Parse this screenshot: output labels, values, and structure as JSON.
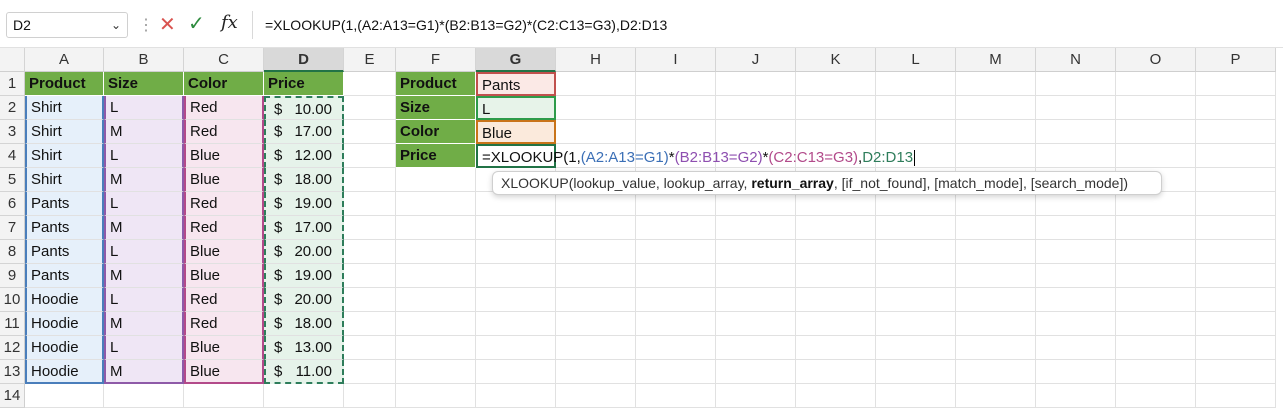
{
  "name_box": "D2",
  "formula_bar": "=XLOOKUP(1,(A2:A13=G1)*(B2:B13=G2)*(C2:C13=G3),D2:D13",
  "columns": [
    "A",
    "B",
    "C",
    "D",
    "E",
    "F",
    "G",
    "H",
    "I",
    "J",
    "K",
    "L",
    "M",
    "N",
    "O",
    "P"
  ],
  "rows": [
    "1",
    "2",
    "3",
    "4",
    "5",
    "6",
    "7",
    "8",
    "9",
    "10",
    "11",
    "12",
    "13",
    "14"
  ],
  "headers": {
    "a": "Product",
    "b": "Size",
    "c": "Color",
    "d": "Price"
  },
  "table": [
    [
      "Shirt",
      "L",
      "Red",
      "$",
      "10.00"
    ],
    [
      "Shirt",
      "M",
      "Red",
      "$",
      "17.00"
    ],
    [
      "Shirt",
      "L",
      "Blue",
      "$",
      "12.00"
    ],
    [
      "Shirt",
      "M",
      "Blue",
      "$",
      "18.00"
    ],
    [
      "Pants",
      "L",
      "Red",
      "$",
      "19.00"
    ],
    [
      "Pants",
      "M",
      "Red",
      "$",
      "17.00"
    ],
    [
      "Pants",
      "L",
      "Blue",
      "$",
      "20.00"
    ],
    [
      "Pants",
      "M",
      "Blue",
      "$",
      "19.00"
    ],
    [
      "Hoodie",
      "L",
      "Red",
      "$",
      "20.00"
    ],
    [
      "Hoodie",
      "M",
      "Red",
      "$",
      "18.00"
    ],
    [
      "Hoodie",
      "L",
      "Blue",
      "$",
      "13.00"
    ],
    [
      "Hoodie",
      "M",
      "Blue",
      "$",
      "11.00"
    ]
  ],
  "lookup": {
    "labels": [
      "Product",
      "Size",
      "Color",
      "Price"
    ],
    "values": [
      "Pants",
      "L",
      "Blue"
    ],
    "edit": {
      "p1": "=XLOOKUP(1,",
      "p2": "(A2:A13=G1)",
      "p3": "*",
      "p4": "(B2:B13=G2)",
      "p5": "*",
      "p6": "(C2:C13=G3)",
      "p7": ",",
      "p8": "D2:D13"
    }
  },
  "tooltip": {
    "before": "XLOOKUP(lookup_value, lookup_array, ",
    "bold": "return_array",
    "after": ", [if_not_found], [match_mode], [search_mode])"
  }
}
